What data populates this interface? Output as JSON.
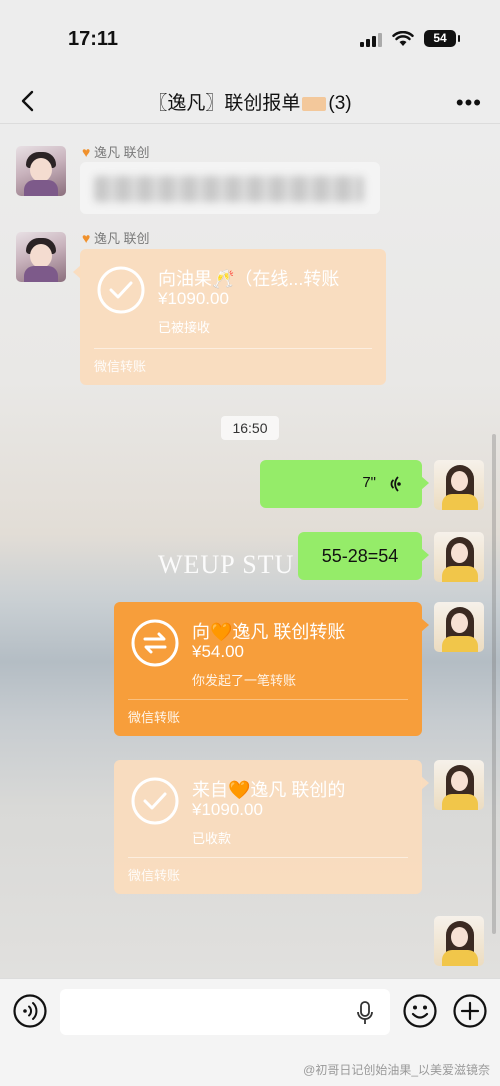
{
  "status_bar": {
    "time": "17:11",
    "battery": "54"
  },
  "nav": {
    "title_prefix": "〖逸凡〗联创报单",
    "title_suffix": "(3)",
    "more": "•••"
  },
  "messages": {
    "sender_name": "逸凡 联创",
    "incoming_receipt": {
      "title": "向油果🥂（在线...转账",
      "amount": "¥1090.00",
      "status": "已被接收",
      "footer": "微信转账"
    },
    "timestamp": "16:50",
    "voice": {
      "duration": "7\""
    },
    "math_text": "55-28=54",
    "outgoing_transfer": {
      "title": "向🧡逸凡 联创转账",
      "amount": "¥54.00",
      "status": "你发起了一笔转账",
      "footer": "微信转账"
    },
    "received_transfer": {
      "title": "来自🧡逸凡 联创的",
      "amount": "¥1090.00",
      "status": "已收款",
      "footer": "微信转账"
    }
  },
  "background_watermark": "WEUP STU",
  "footer_watermark": "@初哥日记创始油果_以美爱滋镜奈",
  "colors": {
    "green_bubble": "#95ec69",
    "orange_transfer": "#f79e3b",
    "pale_transfer": "#fadcbe"
  },
  "icons": [
    "back-icon",
    "more-icon",
    "voice-mode-icon",
    "mic-icon",
    "emoji-icon",
    "plus-icon",
    "check-icon",
    "transfer-arrows-icon",
    "voice-wave-icon"
  ]
}
